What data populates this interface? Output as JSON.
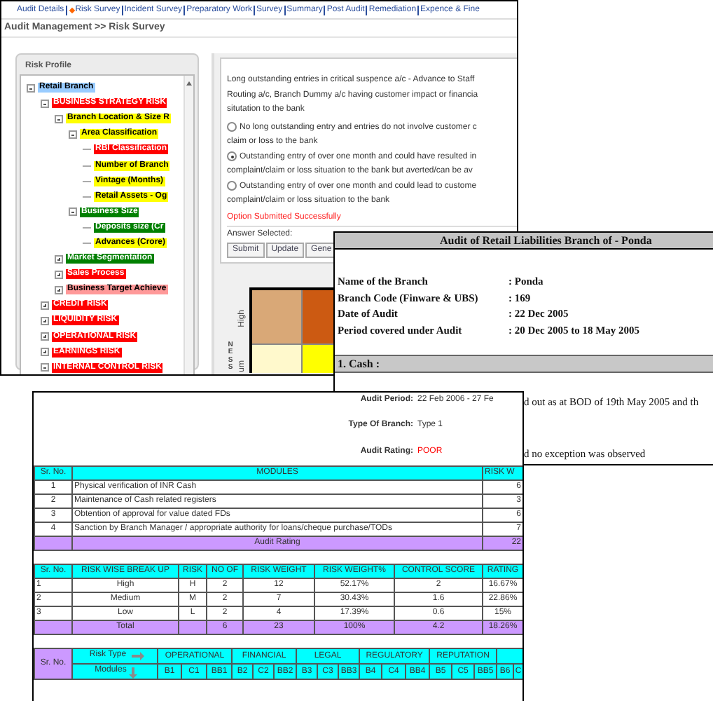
{
  "risk_survey_window": {
    "nav_links": [
      {
        "label": "Audit Details",
        "selected": false
      },
      {
        "label": "Risk Survey",
        "selected": true
      },
      {
        "label": "Incident Survey",
        "selected": false
      },
      {
        "label": "Preparatory Work",
        "selected": false
      },
      {
        "label": "Survey",
        "selected": false
      },
      {
        "label": "Summary",
        "selected": false
      },
      {
        "label": "Post Audit",
        "selected": false
      },
      {
        "label": "Remediation",
        "selected": false
      },
      {
        "label": "Expence & Fine",
        "selected": false
      }
    ],
    "title": "Audit Management >> Risk Survey",
    "risk_profile": {
      "title": "Risk Profile",
      "tree": [
        {
          "label": "Retail Branch",
          "color": "#99ccff",
          "kind": "node",
          "expanded": true,
          "children": [
            {
              "label": "BUSINESS STRATEGY RISK",
              "color": "#ff0000",
              "kind": "node",
              "expanded": true,
              "children": [
                {
                  "label": "Branch Location & Size R",
                  "color": "#ffff00",
                  "kind": "node",
                  "expanded": true,
                  "children": [
                    {
                      "label": "Area Classification",
                      "color": "#ffff00",
                      "kind": "node",
                      "expanded": true,
                      "children": [
                        {
                          "label": "RBI Classification",
                          "color": "#ff0000",
                          "kind": "leaf"
                        },
                        {
                          "label": "Number of Branch",
                          "color": "#ffff00",
                          "kind": "leaf"
                        },
                        {
                          "label": "Vintage (Months)",
                          "color": "#ffff00",
                          "kind": "leaf"
                        },
                        {
                          "label": "Retail Assets - Og",
                          "color": "#ffff00",
                          "kind": "leaf"
                        }
                      ]
                    },
                    {
                      "label": "Business Size",
                      "color": "#008000",
                      "kind": "node",
                      "expanded": true,
                      "children": [
                        {
                          "label": "Deposits size (Cr",
                          "color": "#008000",
                          "kind": "leaf"
                        },
                        {
                          "label": "Advances (Crore)",
                          "color": "#ffff00",
                          "kind": "leaf"
                        }
                      ]
                    }
                  ]
                },
                {
                  "label": "Market Segmentation",
                  "color": "#008000",
                  "kind": "node",
                  "expanded": false
                },
                {
                  "label": "Sales Process",
                  "color": "#ff0000",
                  "kind": "node",
                  "expanded": false
                },
                {
                  "label": "Business Target Achieve",
                  "color": "#ff9999",
                  "kind": "node",
                  "expanded": false
                }
              ]
            },
            {
              "label": "CREDIT RISK",
              "color": "#ff0000",
              "kind": "node",
              "expanded": false
            },
            {
              "label": "LIQUIDITY RISK",
              "color": "#ff0000",
              "kind": "node",
              "expanded": false
            },
            {
              "label": "OPERATIONAL RISK",
              "color": "#ff0000",
              "kind": "node",
              "expanded": false
            },
            {
              "label": "EARNINGS RISK",
              "color": "#ff0000",
              "kind": "node",
              "expanded": false
            },
            {
              "label": "INTERNAL CONTROL RISK",
              "color": "#ff0000",
              "kind": "node",
              "expanded": true
            }
          ]
        }
      ]
    },
    "question": {
      "lines": [
        "Long outstanding entries in critical suspence a/c - Advance to Staff",
        "Routing a/c, Branch Dummy a/c having customer impact or financia",
        "situtation to the bank"
      ],
      "options": [
        {
          "lines": [
            "No long outstanding entry and entries do not involve customer c",
            "claim or loss to the bank"
          ],
          "selected": false
        },
        {
          "lines": [
            "Outstanding entry of over one month and could have resulted in",
            "complaint/claim or loss situation to the bank but averted/can be av"
          ],
          "selected": true
        },
        {
          "lines": [
            "Outstanding entry of over one month and could lead to custome",
            "complaint/claim or loss situation to the bank"
          ],
          "selected": false
        }
      ],
      "status": "Option Submitted Successfully",
      "answer_label": "Answer Selected:",
      "buttons": [
        "Submit",
        "Update",
        "Gene"
      ]
    },
    "heatmap": {
      "axis_label": "NESS",
      "row_labels": [
        "High",
        "um"
      ]
    }
  },
  "branch_audit_window": {
    "title": "Audit of Retail Liabilities Branch of - Ponda",
    "fields": [
      {
        "label": "Name of the Branch",
        "value": ": Ponda"
      },
      {
        "label": "Branch Code (Finware & UBS)",
        "value": ": 169"
      },
      {
        "label": "Date of Audit",
        "value": ": 22 Dec 2005"
      },
      {
        "label": "Period covered under Audit",
        "value": ": 20 Dec 2005 to 18 May 2005"
      }
    ],
    "section": "1. Cash :",
    "text_lines": [
      "d out as at BOD of 19th May 2005 and th",
      "d no exception was observed"
    ]
  },
  "audit_rating_window": {
    "summary": [
      {
        "label": "Audit Period:",
        "value": "22 Feb 2006  - 27 Fe",
        "color": "#333333"
      },
      {
        "label": "Type Of Branch:",
        "value": "Type 1",
        "color": "#333333"
      },
      {
        "label": "Audit Rating:",
        "value": "POOR",
        "color": "#ff0000"
      }
    ],
    "modules_table": {
      "columns": [
        "Sr. No.",
        "MODULES",
        "RISK W"
      ],
      "rows": [
        [
          "1",
          "Physical verification of INR Cash",
          "6"
        ],
        [
          "2",
          "Maintenance of Cash related registers",
          "3"
        ],
        [
          "3",
          "Obtention of approval for value dated FDs",
          "6"
        ],
        [
          "4",
          "Sanction by Branch Manager / appropriate authority for loans/cheque purchase/TODs",
          "7"
        ]
      ],
      "footer": {
        "label": "Audit Rating",
        "value": "22"
      }
    },
    "risk_table": {
      "columns": [
        "Sr. No.",
        "RISK WISE BREAK UP",
        "RISK",
        "NO OF",
        "RISK WEIGHT",
        "RISK WEIGHT%",
        "CONTROL SCORE",
        "RATING"
      ],
      "rows": [
        [
          "1",
          "High",
          "H",
          "2",
          "12",
          "52.17%",
          "2",
          "16.67%"
        ],
        [
          "2",
          "Medium",
          "M",
          "2",
          "7",
          "30.43%",
          "1.6",
          "22.86%"
        ],
        [
          "3",
          "Low",
          "L",
          "2",
          "4",
          "17.39%",
          "0.6",
          "15%"
        ]
      ],
      "total": {
        "label": "Total",
        "no_of": "6",
        "risk_weight": "23",
        "percent": "100%",
        "control_score": "4.2",
        "rating": "18.26%"
      }
    },
    "matrix_table": {
      "corner": "Sr. No.",
      "row_label": "Risk Type",
      "column_label": "Modules",
      "groups": [
        "OPERATIONAL",
        "FINANCIAL",
        "LEGAL",
        "REGULATORY",
        "REPUTATION"
      ],
      "codes": [
        "B1",
        "C1",
        "BB1",
        "B2",
        "C2",
        "BB2",
        "B3",
        "C3",
        "BB3",
        "B4",
        "C4",
        "BB4",
        "B5",
        "C5",
        "BB5",
        "B6",
        "C"
      ]
    }
  }
}
